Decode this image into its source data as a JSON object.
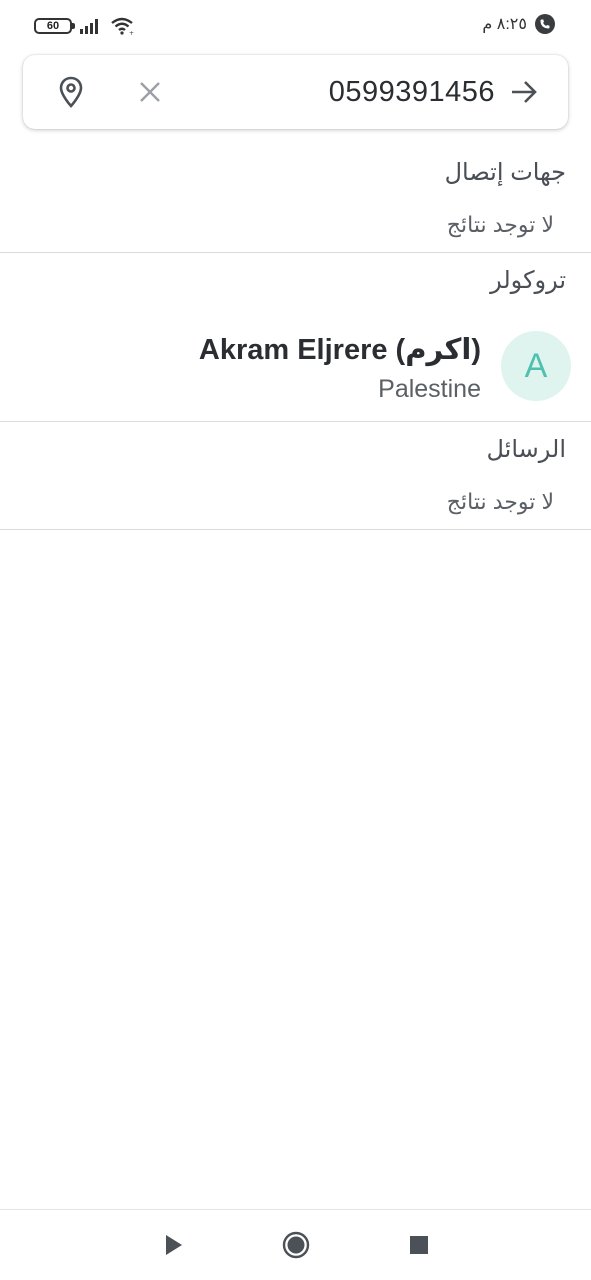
{
  "status_bar": {
    "time": "٨:٢٥ م",
    "battery": "60",
    "icons": [
      "battery-icon",
      "signal-icon",
      "wifi-icon",
      "phone-call-icon"
    ]
  },
  "search": {
    "value": "0599391456",
    "icons": [
      "location-pin-icon",
      "close-icon",
      "arrow-forward-icon"
    ]
  },
  "sections": {
    "contacts": {
      "title": "جهات إتصال",
      "empty": "لا توجد نتائج"
    },
    "truecaller": {
      "title": "تروكولر",
      "result": {
        "avatar_letter": "A",
        "name": "Akram Eljrere (اكرم)",
        "country": "Palestine"
      }
    },
    "messages": {
      "title": "الرسائل",
      "empty": "لا توجد نتائج"
    }
  },
  "colors": {
    "avatar_bg": "#dff3ef",
    "avatar_fg": "#4fc0ad",
    "divider": "#d9dcdf"
  },
  "nav": {
    "icons": [
      "play-icon",
      "home-circle-icon",
      "stop-square-icon"
    ]
  }
}
